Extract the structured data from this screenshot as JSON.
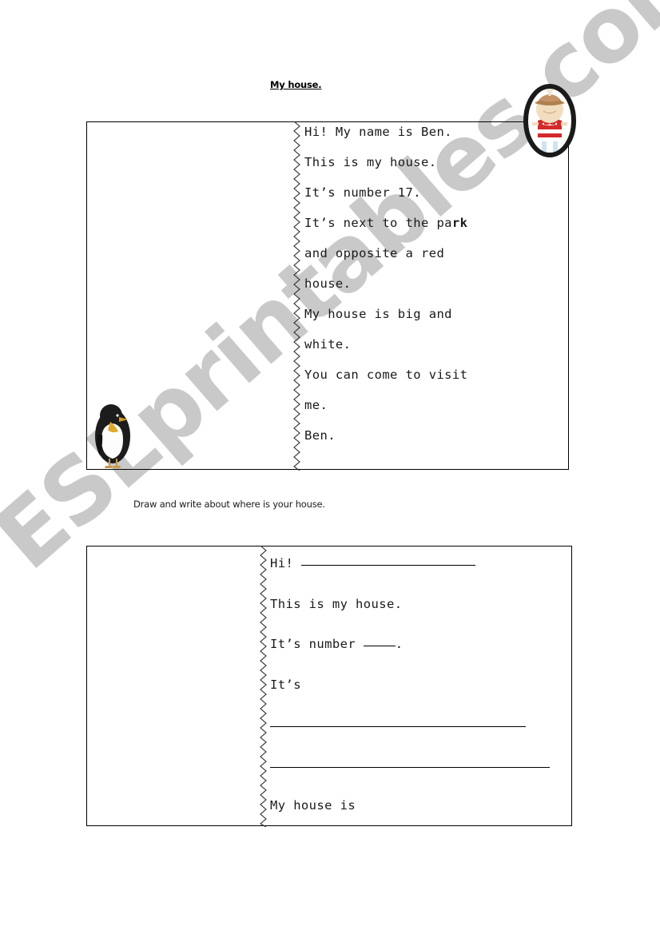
{
  "page": {
    "title": "My house.",
    "instruction": "Draw and write about where is your house.",
    "watermark": "ESLprintables.com",
    "watermark_color": "#c9c9c9"
  },
  "letter_sample": {
    "lines": [
      "Hi! My name is Ben.",
      "This is my house.",
      "It’s number 17.",
      "It’s next to the park",
      "and opposite a red",
      "house.",
      "My house is big and",
      "white.",
      "You can come to visit",
      "me.",
      "Ben."
    ],
    "line4_plain": "It’s next to the pa",
    "line4_bold": "rk",
    "house_number": "17",
    "author": "Ben"
  },
  "letter_exercise": {
    "line_hi": "Hi!",
    "line_this": "This is my house.",
    "line_number_pre": "It’s number",
    "line_number_post": ".",
    "line_its": "It’s",
    "line_myhouse": "My house is"
  },
  "artwork": {
    "penguin": "penguin-clipart",
    "portrait": "boy-oval-portrait",
    "portrait_frame_color": "#1a1a1a",
    "portrait_shirt_color": "#d42a2a",
    "portrait_skin_color": "#f2ddbf",
    "portrait_hat_color": "#b08050"
  }
}
